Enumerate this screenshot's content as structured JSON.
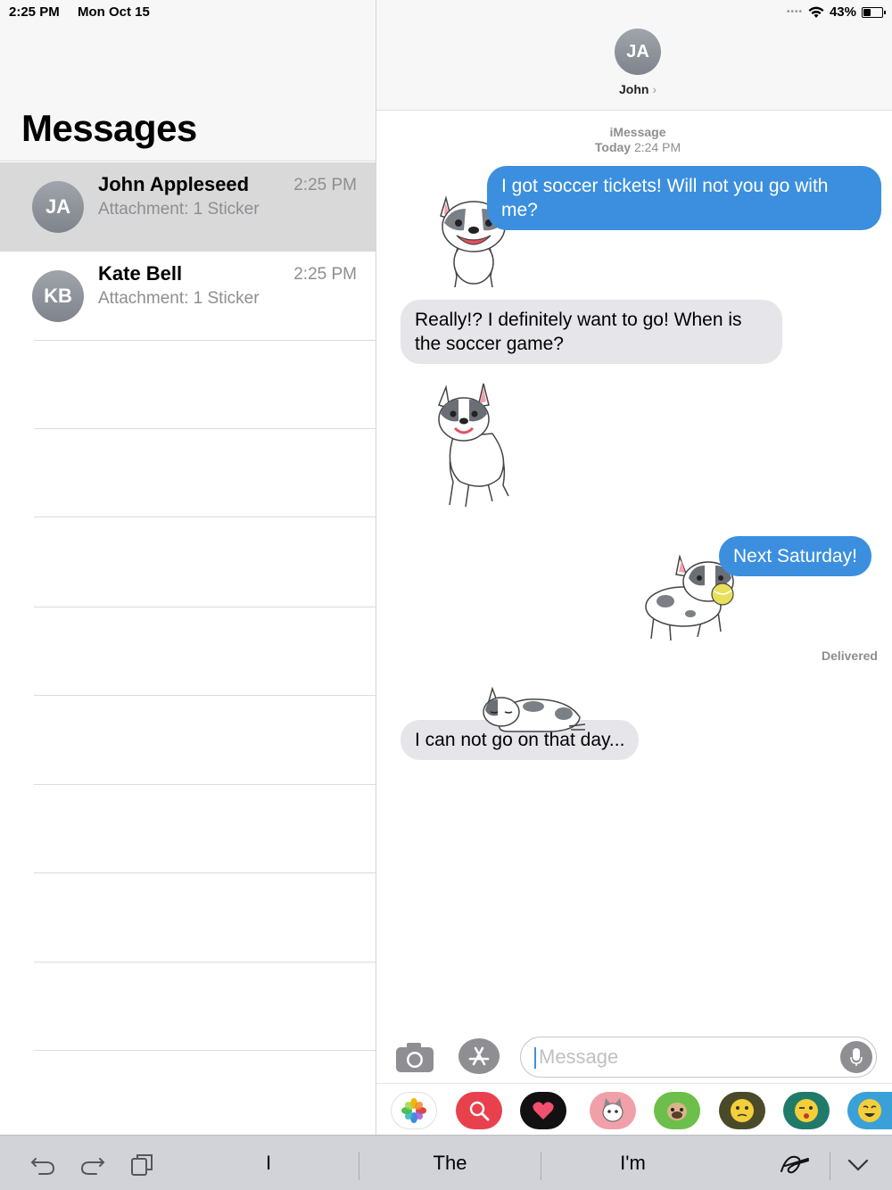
{
  "status_bar": {
    "time": "2:25 PM",
    "date": "Mon Oct 15",
    "battery": "43%",
    "battery_level": 0.43
  },
  "sidebar": {
    "title": "Messages",
    "conversations": [
      {
        "initials": "JA",
        "name": "John Appleseed",
        "preview": "Attachment: 1 Sticker",
        "time": "2:25 PM",
        "selected": true
      },
      {
        "initials": "KB",
        "name": "Kate Bell",
        "preview": "Attachment: 1 Sticker",
        "time": "2:25 PM",
        "selected": false
      }
    ]
  },
  "chat": {
    "contact_initials": "JA",
    "contact_name": "John",
    "chevron": "›",
    "service": "iMessage",
    "timestamp_day": "Today",
    "timestamp_time": "2:24 PM",
    "messages": [
      {
        "direction": "outgoing",
        "text": "I got soccer tickets! Will not you go with me?"
      },
      {
        "direction": "incoming",
        "text": "Really!? I definitely want to go! When is the soccer game?"
      },
      {
        "direction": "outgoing",
        "text": "Next Saturday!"
      },
      {
        "direction": "incoming",
        "text": "I can not go on that day..."
      }
    ],
    "delivered_label": "Delivered",
    "stickers": [
      "bulldog-smiling-sticker",
      "bulldog-standing-sticker",
      "bulldog-ball-sticker",
      "bulldog-lying-sticker"
    ],
    "compose": {
      "placeholder": "Message"
    },
    "app_strip": [
      "photos-app-icon",
      "search-images-app-icon",
      "digital-touch-app-icon",
      "cat-sticker-app-icon",
      "dog-sticker-app-icon",
      "emoji-sticker-app-icon",
      "emoji-sticker-app-icon-2",
      "emoji-sticker-app-icon-3"
    ]
  },
  "keyboard_bar": {
    "suggestions": [
      "I",
      "The",
      "I'm"
    ],
    "icons": [
      "undo-icon",
      "redo-icon",
      "paste-icon",
      "handwriting-icon",
      "dismiss-keyboard-icon"
    ]
  },
  "colors": {
    "outgoing_bubble": "#3b8fde",
    "incoming_bubble": "#e6e6ea",
    "selected_row": "#d9d9d9",
    "keyboard_bar": "#d1d3d9"
  }
}
